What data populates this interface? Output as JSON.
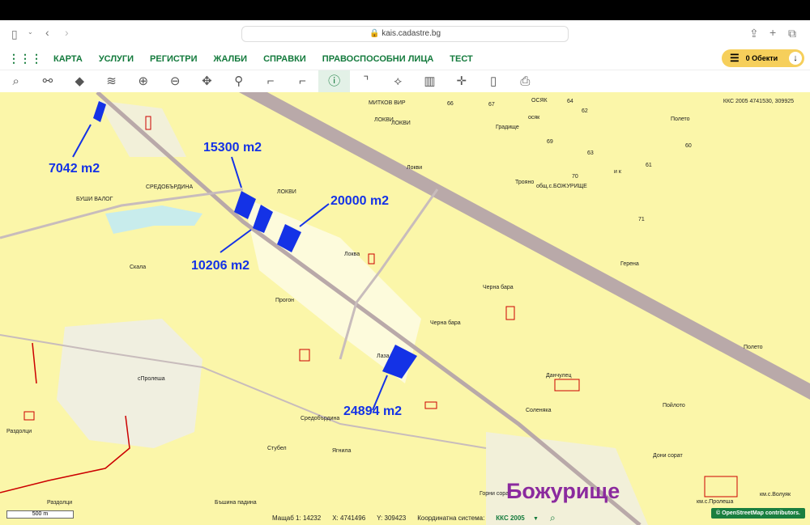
{
  "browser": {
    "url": "kais.cadastre.bg"
  },
  "nav": {
    "items": [
      "КАРТА",
      "УСЛУГИ",
      "РЕГИСТРИ",
      "ЖАЛБИ",
      "СПРАВКИ",
      "ПРАВОСПОСОБНИ ЛИЦА",
      "ТЕСТ"
    ],
    "objects_label": "0 Обекти"
  },
  "toolbar": {
    "tools": [
      "search-icon",
      "measure-icon",
      "layers-icon",
      "layers-stack-icon",
      "zoom-in-icon",
      "zoom-out-icon",
      "pan-icon",
      "marker-icon",
      "select-add-icon",
      "select-remove-icon",
      "info-icon",
      "sketch-icon",
      "polygon-icon",
      "map-icon",
      "coordinates-icon",
      "document-icon",
      "print-icon"
    ],
    "active": "info-icon"
  },
  "map": {
    "crs_readout": "ККС 2005 4741530, 309925",
    "town_label": "Божурище",
    "area_labels": [
      "7042 m2",
      "15300 m2",
      "20000 m2",
      "10206 m2",
      "24894 m2"
    ],
    "place_labels": [
      "МИТКОВ ВИР",
      "ЛОКВИ",
      "ЛОКВИ",
      "Локви",
      "ЛОКВИ",
      "СРЕДОБЪРДИНА",
      "БУШИ ВАЛОГ",
      "Скала",
      "Локва",
      "Прогон",
      "Черна бара",
      "Черна бара",
      "Лаза",
      "Данчулец",
      "Соленяка",
      "Пойлото",
      "Средобърдина",
      "сПролеша",
      "Раздолци",
      "Стубел",
      "Ягнила",
      "Дони сорат",
      "Горни сорат",
      "Бъшина падина",
      "Раздолци",
      "ОСЯК",
      "осяк",
      "Градище",
      "Полето",
      "Троянo",
      "общ.с.БОЖУРИЩЕ",
      "Герена",
      "Полето",
      "км.с.Пролеша",
      "км.с.Волуяк",
      "и к",
      "66",
      "67",
      "64",
      "62",
      "69",
      "63",
      "70",
      "61",
      "60",
      "71"
    ],
    "colors": {
      "parcel": "#1432e6",
      "background": "#fbf6a9",
      "road": "#b9a9a9"
    }
  },
  "status": {
    "scale_label": "Мащаб 1:",
    "scale": "14232",
    "x_label": "X:",
    "x": "4741496",
    "y_label": "Y:",
    "y": "309423",
    "crs_label": "Координатна система:",
    "crs": "ККС 2005",
    "scalebar": "500 m",
    "attribution": "© OpenStreetMap contributors."
  }
}
